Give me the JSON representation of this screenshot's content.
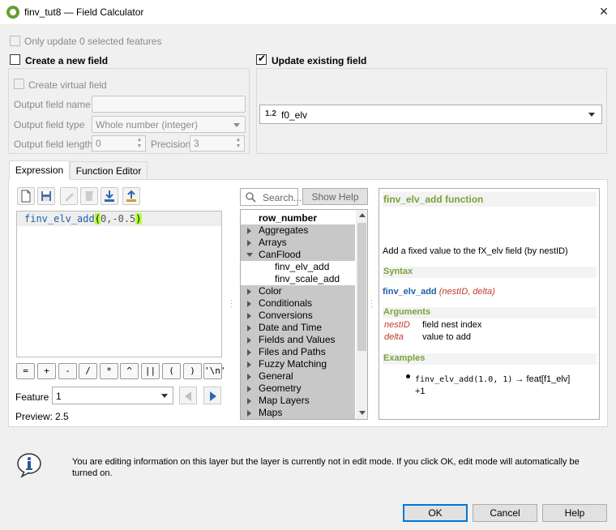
{
  "window": {
    "title": "finv_tut8 — Field Calculator",
    "close_icon": "×"
  },
  "top": {
    "only_update": "Only update 0 selected features",
    "create_new_field": "Create a new field",
    "update_existing_field": "Update existing field"
  },
  "new_field": {
    "create_virtual": "Create virtual field",
    "output_name_label": "Output field name",
    "output_type_label": "Output field type",
    "output_type_value": "Whole number (integer)",
    "output_length_label": "Output field length",
    "output_length_value": "0",
    "precision_label": "Precision",
    "precision_value": "3"
  },
  "existing_field": {
    "type_badge": "1.2",
    "value": "f0_elv"
  },
  "tabs": {
    "expression": "Expression",
    "function_editor": "Function Editor"
  },
  "editor": {
    "fn": "finv_elv_add",
    "lparen": "(",
    "args": "0,-0.5",
    "rparen": ")"
  },
  "operators": [
    "=",
    "+",
    "-",
    "/",
    "*",
    "^",
    "||",
    "(",
    ")",
    "'\\n'"
  ],
  "feature": {
    "label": "Feature",
    "value": "1",
    "preview_label": "Preview:",
    "preview_value": "2.5"
  },
  "search": {
    "placeholder": "Search...",
    "show_help": "Show Help"
  },
  "tree": {
    "first": "row_number",
    "groups_a": [
      "Aggregates",
      "Arrays"
    ],
    "open_group": "CanFlood",
    "children": [
      "finv_elv_add",
      "finv_scale_add"
    ],
    "groups_b": [
      "Color",
      "Conditionals",
      "Conversions",
      "Date and Time",
      "Fields and Values",
      "Files and Paths",
      "Fuzzy Matching",
      "General",
      "Geometry",
      "Map Layers",
      "Maps"
    ]
  },
  "help": {
    "title": "finv_elv_add function",
    "description": "Add a fixed value to the fX_elv field (by nestID)",
    "syntax_heading": "Syntax",
    "syntax_fn": "finv_elv_add",
    "syntax_args": "(nestID, delta)",
    "arguments_heading": "Arguments",
    "arguments": [
      {
        "name": "nestID",
        "desc": "field nest index"
      },
      {
        "name": "delta",
        "desc": "value to add"
      }
    ],
    "examples_heading": "Examples",
    "example_code": "finv_elv_add(1.0, 1)",
    "example_result": "→ feat[f1_elv]",
    "example_result2": "+1"
  },
  "notice": {
    "text": "You are editing information on this layer but the layer is currently not in edit mode. If you click OK, edit mode will automatically be turned on."
  },
  "buttons": {
    "ok": "OK",
    "cancel": "Cancel",
    "help": "Help"
  },
  "colors": {
    "accent": "#0078d7",
    "help_heading": "#7aa23a",
    "fn_name": "#1f5fa8",
    "arg_name": "#c0392b",
    "paren_highlight": "#b6ff3a"
  }
}
